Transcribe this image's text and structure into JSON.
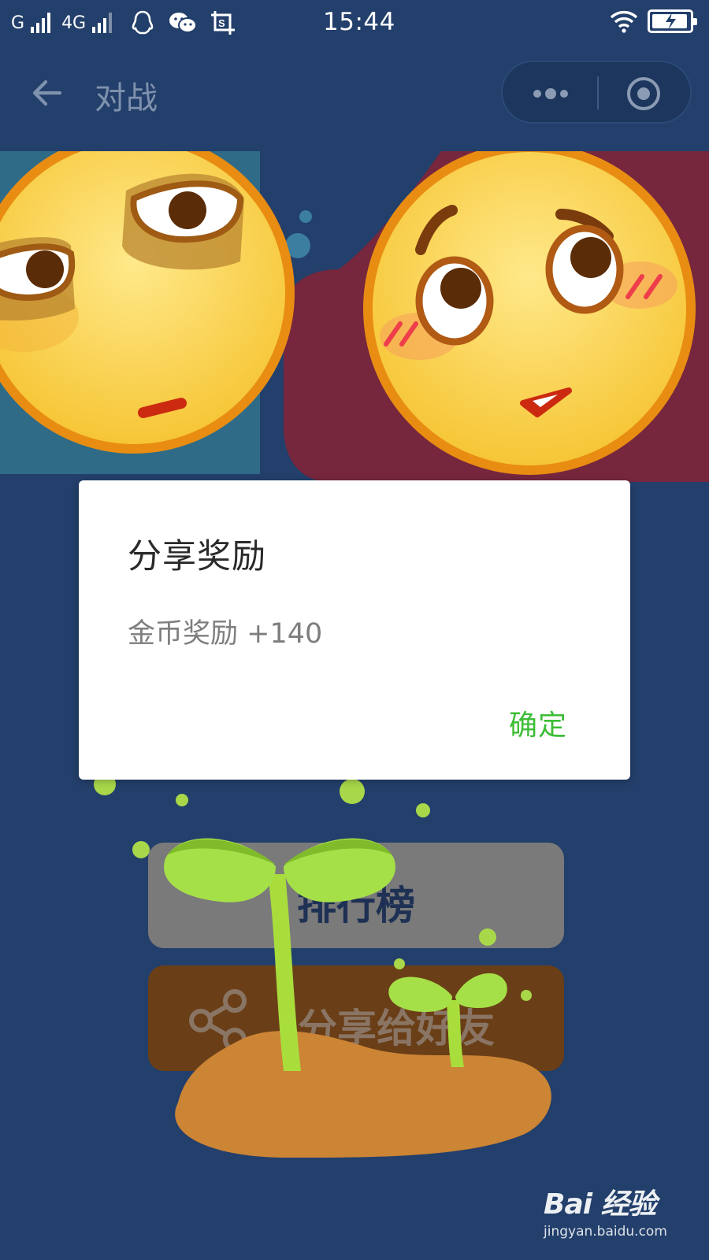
{
  "status_bar": {
    "carrier_1": "G",
    "carrier_2": "4G",
    "time": "15:44",
    "icons": [
      "signal-icon",
      "qq-icon",
      "wechat-icon",
      "screenshot-icon",
      "wifi-icon",
      "battery-charging-icon"
    ]
  },
  "nav": {
    "title": "对战"
  },
  "dialog": {
    "title": "分享奖励",
    "message": "金币奖励 +140",
    "confirm_label": "确定",
    "confirm_color": "#3dbd36"
  },
  "buttons": {
    "rank_label": "排行榜",
    "share_label": "分享给好友"
  },
  "watermark": {
    "logo_text": "Bai 经验",
    "url": "jingyan.baidu.com"
  },
  "colors": {
    "background": "#233f6b",
    "banner_left": "#2f6b87",
    "banner_right": "#76273d"
  }
}
